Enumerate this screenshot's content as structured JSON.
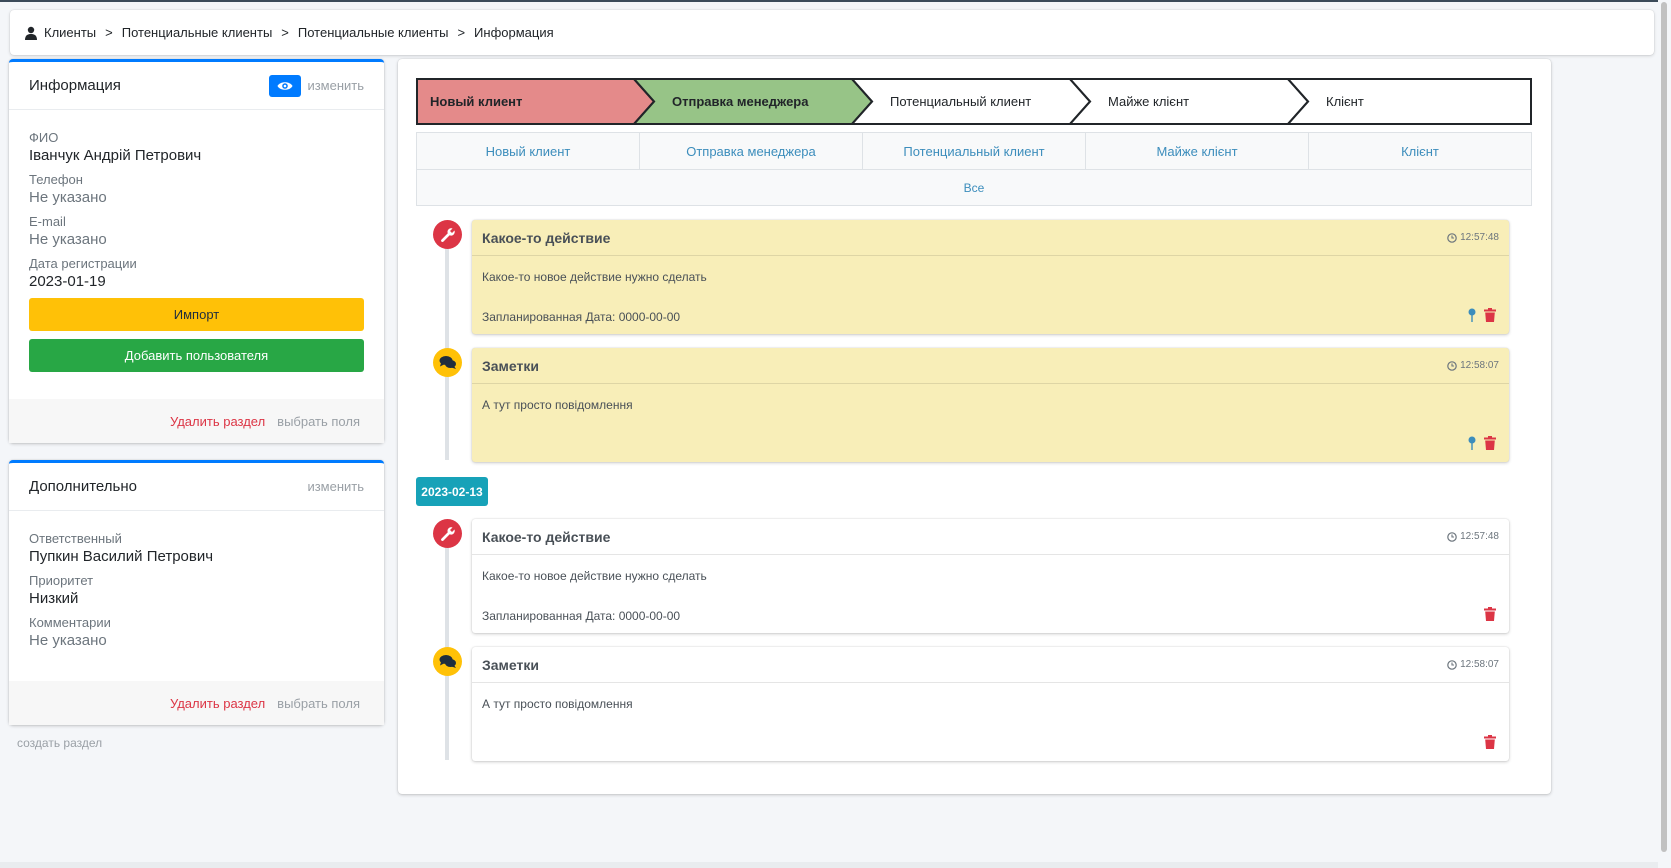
{
  "breadcrumb": {
    "items": [
      "Клиенты",
      "Потенциальные клиенты",
      "Потенциальные клиенты",
      "Информация"
    ],
    "separator": ">"
  },
  "info_card": {
    "title": "Информация",
    "edit_label": "изменить",
    "fields": [
      {
        "label": "ФИО",
        "value": "Іванчук Андрій Петрович"
      },
      {
        "label": "Телефон",
        "value": "Не указано"
      },
      {
        "label": "E-mail",
        "value": "Не указано"
      },
      {
        "label": "Дата регистрации",
        "value": "2023-01-19"
      }
    ],
    "import_button": "Импорт",
    "add_user_button": "Добавить пользователя",
    "delete_section": "Удалить раздел",
    "choose_fields": "выбрать поля"
  },
  "extra_card": {
    "title": "Дополнительно",
    "edit_label": "изменить",
    "fields": [
      {
        "label": "Ответственный",
        "value": "Пупкин Василий Петрович"
      },
      {
        "label": "Приоритет",
        "value": "Низкий"
      },
      {
        "label": "Комментарии",
        "value": "Не указано"
      }
    ],
    "delete_section": "Удалить раздел",
    "choose_fields": "выбрать поля"
  },
  "create_section": "создать раздел",
  "pipeline": {
    "steps": [
      {
        "label": "Новый клиент",
        "fill": "#e48a8a",
        "bold": true
      },
      {
        "label": "Отправка менеджера",
        "fill": "#97c487",
        "bold": true
      },
      {
        "label": "Потенциальный клиент",
        "fill": "#ffffff",
        "bold": false
      },
      {
        "label": "Майже клієнт",
        "fill": "#ffffff",
        "bold": false
      },
      {
        "label": "Клієнт",
        "fill": "#ffffff",
        "bold": false
      }
    ]
  },
  "stage_tabs": {
    "items": [
      "Новый клиент",
      "Отправка менеджера",
      "Потенциальный клиент",
      "Майже клієнт",
      "Клієнт"
    ],
    "all": "Все"
  },
  "timeline": {
    "date_badge": "2023-02-13",
    "events": [
      {
        "type": "action",
        "title": "Какое-то действие",
        "time": "12:57:48",
        "text": "Какое-то новое действие нужно сделать",
        "planned": "Запланированная Дата: 0000-00-00",
        "icon": "wrench-icon"
      },
      {
        "type": "note",
        "title": "Заметки",
        "time": "12:58:07",
        "text": "А тут просто повідомлення",
        "icon": "comments-icon"
      },
      {
        "type": "action",
        "title": "Какое-то действие",
        "time": "12:57:48",
        "text": "Какое-то новое действие нужно сделать",
        "planned": "Запланированная Дата: 0000-00-00",
        "icon": "wrench-icon"
      },
      {
        "type": "note",
        "title": "Заметки",
        "time": "12:58:07",
        "text": "А тут просто повідомлення",
        "icon": "comments-icon"
      }
    ]
  },
  "colors": {
    "primary": "#007bff",
    "success": "#28a745",
    "warning": "#ffc107",
    "danger": "#dc3545",
    "info": "#17a2b8",
    "link": "#3c8dbc",
    "note_bg": "#f8eeb8"
  }
}
